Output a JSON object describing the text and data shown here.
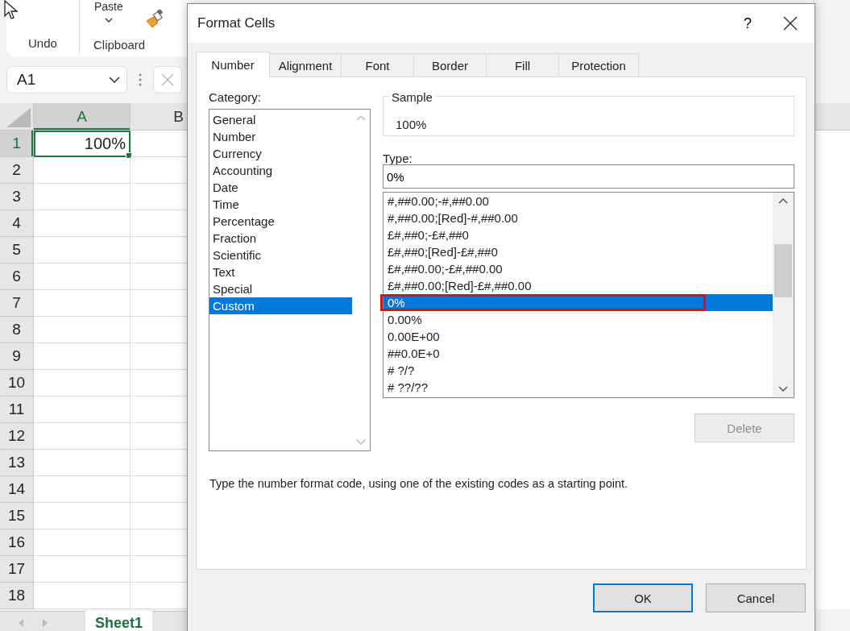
{
  "ribbon": {
    "groups": [
      {
        "label": "Undo"
      },
      {
        "label": "Clipboard",
        "button": "Paste"
      }
    ]
  },
  "name_box": {
    "value": "A1"
  },
  "sheet": {
    "columns": [
      {
        "label": "A",
        "selected": true
      },
      {
        "label": "B",
        "selected": false
      }
    ],
    "rows": [
      {
        "label": "1",
        "selected": true
      },
      {
        "label": "2",
        "selected": false
      },
      {
        "label": "3",
        "selected": false
      },
      {
        "label": "4",
        "selected": false
      },
      {
        "label": "5",
        "selected": false
      },
      {
        "label": "6",
        "selected": false
      },
      {
        "label": "7",
        "selected": false
      },
      {
        "label": "8",
        "selected": false
      },
      {
        "label": "9",
        "selected": false
      },
      {
        "label": "10",
        "selected": false
      },
      {
        "label": "11",
        "selected": false
      },
      {
        "label": "12",
        "selected": false
      },
      {
        "label": "13",
        "selected": false
      },
      {
        "label": "14",
        "selected": false
      },
      {
        "label": "15",
        "selected": false
      },
      {
        "label": "16",
        "selected": false
      },
      {
        "label": "17",
        "selected": false
      },
      {
        "label": "18",
        "selected": false
      }
    ],
    "cell_a1": "100%"
  },
  "sheet_tabs": [
    {
      "label": "Sheet1",
      "selected": true
    }
  ],
  "dialog": {
    "title": "Format Cells",
    "help": "?",
    "tabs": [
      {
        "label": "Number",
        "selected": true
      },
      {
        "label": "Alignment",
        "selected": false
      },
      {
        "label": "Font",
        "selected": false
      },
      {
        "label": "Border",
        "selected": false
      },
      {
        "label": "Fill",
        "selected": false
      },
      {
        "label": "Protection",
        "selected": false
      }
    ],
    "category_label": "Category:",
    "categories": [
      {
        "label": "General",
        "selected": false
      },
      {
        "label": "Number",
        "selected": false
      },
      {
        "label": "Currency",
        "selected": false
      },
      {
        "label": "Accounting",
        "selected": false
      },
      {
        "label": "Date",
        "selected": false
      },
      {
        "label": "Time",
        "selected": false
      },
      {
        "label": "Percentage",
        "selected": false
      },
      {
        "label": "Fraction",
        "selected": false
      },
      {
        "label": "Scientific",
        "selected": false
      },
      {
        "label": "Text",
        "selected": false
      },
      {
        "label": "Special",
        "selected": false
      },
      {
        "label": "Custom",
        "selected": true
      }
    ],
    "sample_label": "Sample",
    "sample_value": "100%",
    "type_label": "Type:",
    "type_value": "0%",
    "formats": [
      {
        "label": "#,##0.00;-#,##0.00",
        "selected": false,
        "highlighted": false
      },
      {
        "label": "#,##0.00;[Red]-#,##0.00",
        "selected": false,
        "highlighted": false
      },
      {
        "label": "£#,##0;-£#,##0",
        "selected": false,
        "highlighted": false
      },
      {
        "label": "£#,##0;[Red]-£#,##0",
        "selected": false,
        "highlighted": false
      },
      {
        "label": "£#,##0.00;-£#,##0.00",
        "selected": false,
        "highlighted": false
      },
      {
        "label": "£#,##0.00;[Red]-£#,##0.00",
        "selected": false,
        "highlighted": false
      },
      {
        "label": "0%",
        "selected": true,
        "highlighted": true
      },
      {
        "label": "0.00%",
        "selected": false,
        "highlighted": false
      },
      {
        "label": "0.00E+00",
        "selected": false,
        "highlighted": false
      },
      {
        "label": "##0.0E+0",
        "selected": false,
        "highlighted": false
      },
      {
        "label": "# ?/?",
        "selected": false,
        "highlighted": false
      },
      {
        "label": "# ??/??",
        "selected": false,
        "highlighted": false
      }
    ],
    "delete_button": {
      "label": "Delete",
      "disabled": true
    },
    "description": "Type the number format code, using one of the existing codes as a starting point.",
    "buttons": [
      {
        "label": "OK",
        "default": true
      },
      {
        "label": "Cancel",
        "default": false
      }
    ]
  }
}
